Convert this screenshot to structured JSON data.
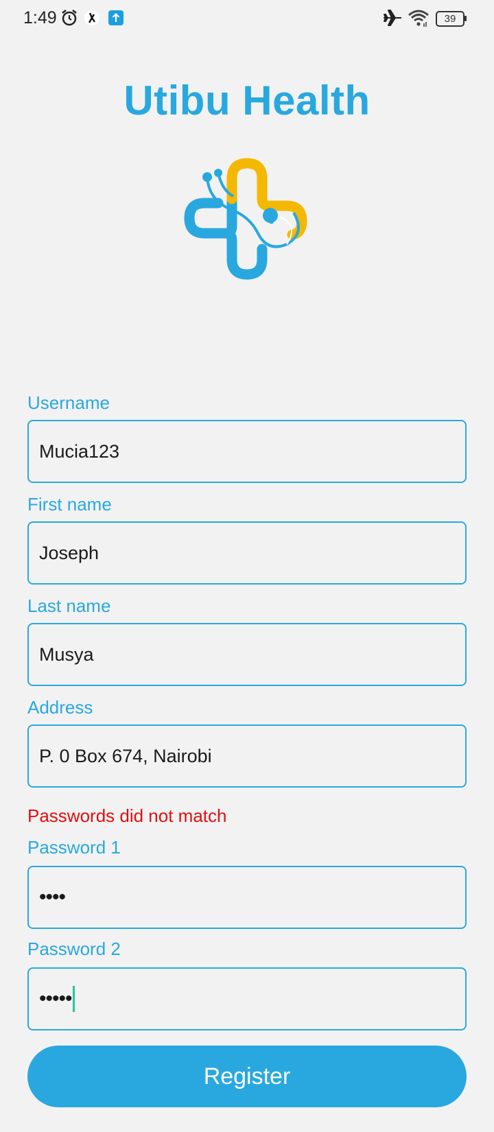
{
  "status_bar": {
    "time": "1:49",
    "battery": "39",
    "icons": [
      "alarm-icon",
      "app-notification-icon",
      "upload-icon",
      "airplane-mode-icon",
      "wifi-icon",
      "battery-icon"
    ]
  },
  "app": {
    "title": "Utibu Health"
  },
  "form": {
    "username": {
      "label": "Username",
      "value": "Mucia123"
    },
    "first_name": {
      "label": "First name",
      "value": "Joseph"
    },
    "last_name": {
      "label": "Last name",
      "value": "Musya"
    },
    "address": {
      "label": "Address",
      "value": "P. 0 Box 674, Nairobi"
    },
    "error": "Passwords did not match",
    "password1": {
      "label": "Password 1",
      "value": "••••"
    },
    "password2": {
      "label": "Password 2",
      "value": "•••••"
    },
    "register_label": "Register"
  },
  "colors": {
    "accent": "#29a8df",
    "error": "#e20f0f",
    "logo_yellow": "#f5b800",
    "background": "#f2f2f2"
  }
}
